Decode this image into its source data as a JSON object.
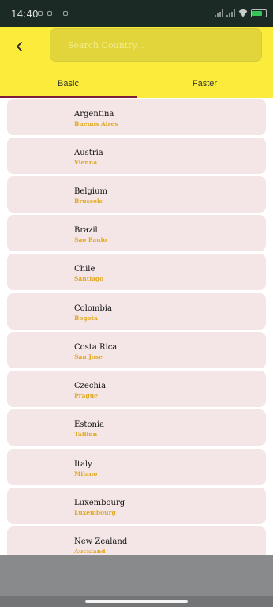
{
  "status_bar": {
    "time": "14:40"
  },
  "header": {
    "search": {
      "placeholder": "Search Country..."
    }
  },
  "tabs": [
    {
      "label": "Basic",
      "selected": true
    },
    {
      "label": "Faster",
      "selected": false
    }
  ],
  "countries": [
    {
      "name": "Argentina",
      "capital": "Buenos Aires"
    },
    {
      "name": "Austria",
      "capital": "Vienna"
    },
    {
      "name": "Belgium",
      "capital": "Brussels"
    },
    {
      "name": "Brazil",
      "capital": "Sao Paulo"
    },
    {
      "name": "Chile",
      "capital": "Santiago"
    },
    {
      "name": "Colombia",
      "capital": "Bogota"
    },
    {
      "name": "Costa Rica",
      "capital": "San Jose"
    },
    {
      "name": "Czechia",
      "capital": "Prague"
    },
    {
      "name": "Estonia",
      "capital": "Tallinn"
    },
    {
      "name": "Italy",
      "capital": "Milano"
    },
    {
      "name": "Luxembourg",
      "capital": "Luxembourg"
    },
    {
      "name": "New Zealand",
      "capital": "Auckland"
    }
  ],
  "colors": {
    "header": "#fbeb3b",
    "tab_indicator": "#7c1e3a",
    "card_background": "#f4e5e6",
    "capital_text": "#e0a923"
  }
}
